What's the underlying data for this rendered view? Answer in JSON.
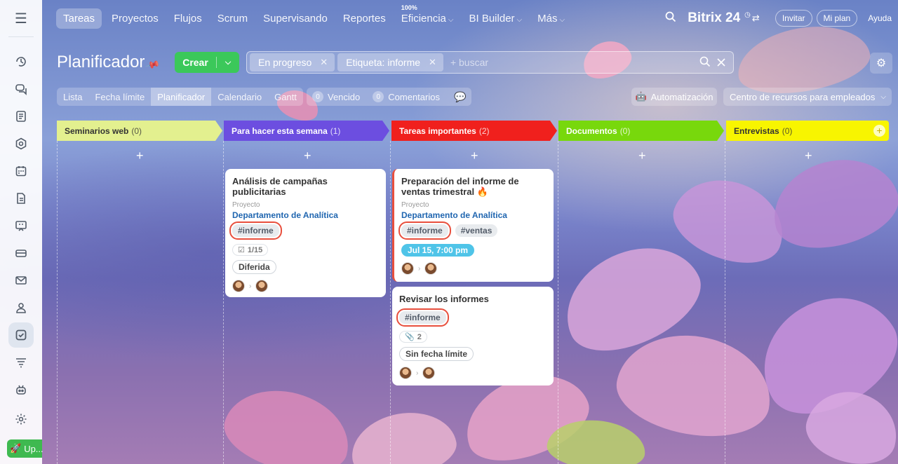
{
  "nav": {
    "items": [
      "Tareas",
      "Proyectos",
      "Flujos",
      "Scrum",
      "Supervisando",
      "Reportes",
      "Eficiencia",
      "BI Builder",
      "Más"
    ],
    "efficiency_value": "100%",
    "brand": "Bitrix 24",
    "invite": "Invitar",
    "my_plan": "Mi plan",
    "help": "Ayuda"
  },
  "header": {
    "title": "Planificador",
    "create_label": "Crear",
    "filters": [
      "En progreso",
      "Etiqueta: informe"
    ],
    "search_placeholder": "+ buscar"
  },
  "views": {
    "tabs": [
      "Lista",
      "Fecha límite",
      "Planificador",
      "Calendario",
      "Gantt"
    ],
    "active": "Planificador",
    "counters": [
      {
        "count": "0",
        "label": "Vencido"
      },
      {
        "count": "0",
        "label": "Comentarios"
      }
    ],
    "automation": "Automatización",
    "resource_center": "Centro de recursos para empleados"
  },
  "columns": [
    {
      "title": "Seminarios web",
      "count": "(0)",
      "color": "#e3f08f"
    },
    {
      "title": "Para hacer esta semana",
      "count": "(1)",
      "color": "#6c4ee0"
    },
    {
      "title": "Tareas importantes",
      "count": "(2)",
      "color": "#f0201d"
    },
    {
      "title": "Documentos",
      "count": "(0)",
      "color": "#78d80c"
    },
    {
      "title": "Entrevistas",
      "count": "(0)",
      "color": "#f8f500"
    }
  ],
  "cards": [
    {
      "title": "Análisis de campañas publicitarias",
      "project_label": "Proyecto",
      "project": "Departamento de Analítica",
      "tags": [
        "#informe"
      ],
      "checklist": "1/15",
      "status": "Diferida"
    },
    {
      "title": "Preparación del informe de ventas trimestral",
      "project_label": "Proyecto",
      "project": "Departamento de Analítica",
      "tags": [
        "#informe",
        "#ventas"
      ],
      "deadline": "Jul 15, 7:00 pm"
    },
    {
      "title": "Revisar los informes",
      "tags": [
        "#informe"
      ],
      "attachments": "2",
      "status": "Sin fecha límite"
    }
  ],
  "rail": {
    "up_label": "Up..."
  }
}
